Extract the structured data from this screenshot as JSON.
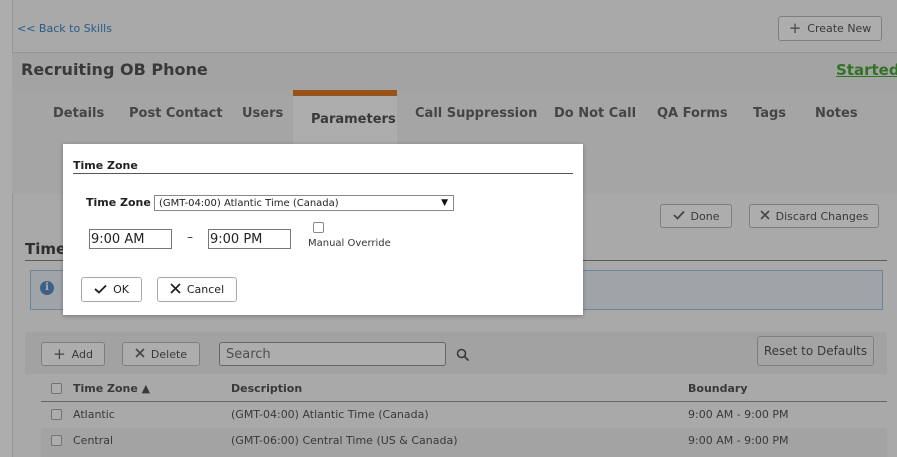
{
  "page": {
    "back_link": "<< Back to Skills",
    "create_new": "Create New",
    "title": "Recruiting OB Phone",
    "status": "Started",
    "tabs": [
      {
        "label": "Details"
      },
      {
        "label": "Post Contact"
      },
      {
        "label": "Users"
      },
      {
        "label": "Parameters"
      },
      {
        "label": "Call Suppression"
      },
      {
        "label": "Do Not Call"
      },
      {
        "label": "QA Forms"
      },
      {
        "label": "Tags"
      },
      {
        "label": "Notes"
      }
    ],
    "done": "Done",
    "discard": "Discard Changes",
    "section_title": "Time",
    "info_icon": "i",
    "toolbar": {
      "add": "Add",
      "delete": "Delete",
      "search_placeholder": "Search",
      "reset": "Reset to Defaults"
    },
    "table": {
      "columns": [
        "Time Zone ▲",
        "Description",
        "Boundary"
      ],
      "rows": [
        {
          "zone": "Atlantic",
          "description": "(GMT-04:00) Atlantic Time (Canada)",
          "boundary": "9:00 AM - 9:00 PM"
        },
        {
          "zone": "Central",
          "description": "(GMT-06:00) Central Time (US & Canada)",
          "boundary": "9:00 AM - 9:00 PM"
        }
      ]
    }
  },
  "modal": {
    "title": "Time Zone",
    "tz_label": "Time Zone",
    "tz_selected": "(GMT-04:00) Atlantic Time (Canada)",
    "start_time": "9:00 AM",
    "dash": "–",
    "end_time": "9:00 PM",
    "override_label": "Manual Override",
    "override_checked": false,
    "ok": "OK",
    "cancel": "Cancel"
  },
  "icons": {
    "plus": "plus-icon",
    "check": "check-icon",
    "times": "close-icon",
    "search": "search-icon",
    "info": "info-icon",
    "dropdown": "dropdown-arrow-icon"
  },
  "colors": {
    "accent_tab": "#e07b28",
    "status_green": "#4aa839",
    "link_blue": "#3b86c6"
  }
}
